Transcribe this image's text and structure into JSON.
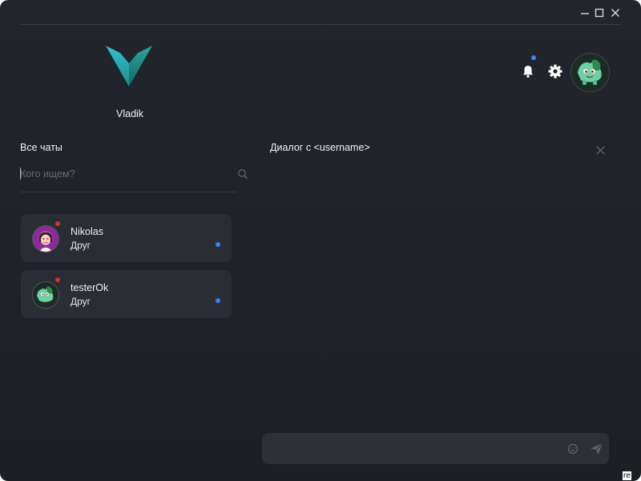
{
  "window": {
    "controls": [
      "minimize-icon",
      "maximize-icon",
      "close-icon"
    ]
  },
  "profile": {
    "name": "Vladik",
    "logo_colors": [
      "#2bb0c9",
      "#1d7e73"
    ]
  },
  "header": {
    "icons": [
      "bell-icon",
      "gear-icon",
      "avatar"
    ],
    "notification_color": "#3b82f6"
  },
  "sidebar": {
    "title": "Все чаты",
    "search_placeholder": "Кого ищем?",
    "chats": [
      {
        "name": "Nikolas",
        "status": "Друг",
        "online_color": "#d4322a",
        "unread": true
      },
      {
        "name": "testerOk",
        "status": "Друг",
        "online_color": "#d4322a",
        "unread": true
      }
    ]
  },
  "dialog": {
    "title": "Диалог с <username>",
    "message_placeholder": ""
  },
  "corner": {
    "text": "re"
  }
}
